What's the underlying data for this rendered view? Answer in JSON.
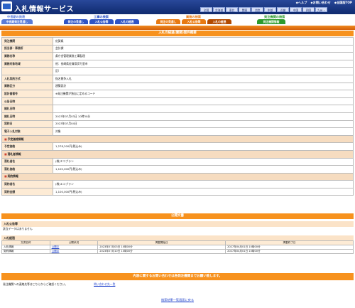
{
  "header": {
    "title": "入札情報サービス",
    "top_links": [
      "◆ヘルプ",
      "◆お問い合わせ",
      "◆全国版TOP"
    ],
    "regions": [
      "全国",
      "北海道",
      "東北",
      "関東",
      "北陸",
      "中部",
      "近畿",
      "中国",
      "四国",
      "九州・沖"
    ]
  },
  "nav": {
    "groups": [
      {
        "label": "中長期の発表",
        "color": "#5a7bd8",
        "buttons": [
          "中長期発注見通し"
        ]
      },
      {
        "label": "工事の検索",
        "color": "#2f54c4",
        "buttons": [
          "発注の見通し",
          "入札公告等",
          "入札の経過"
        ]
      },
      {
        "label": "業務の検索",
        "color": "#e87a12",
        "buttons": [
          "発注の見通し",
          "入札公告等",
          "入札の経過"
        ]
      },
      {
        "label": "発注機関の検索",
        "color": "#2d9a2d",
        "buttons": [
          "発注機関情報"
        ]
      }
    ]
  },
  "section_title": "入札の経過(業務)案件概要",
  "details": [
    {
      "label": "発注機関",
      "value": "佐賀県"
    },
    {
      "label": "担当部・事務所",
      "value": "会計課"
    },
    {
      "label": "業務名称",
      "value": "県庁舎管理業務工事監理"
    },
    {
      "label": "業務対象地域",
      "value": "他：長崎県佐賀県伊万里市"
    },
    {
      "label": "",
      "value": "区）"
    },
    {
      "label": "入札契約方式",
      "value": "指名競争入札"
    },
    {
      "label": "業務区分",
      "value": "建築設計"
    },
    {
      "label": "設計書番号",
      "value": "※発注機関が独自に定めるコード"
    },
    {
      "label": "公告日時",
      "value": ""
    },
    {
      "label": "開札日時",
      "value": ""
    },
    {
      "label": "開札日時",
      "value": "2023年07月03日 10時30分"
    },
    {
      "label": "契約日",
      "value": "2023年07月04日"
    },
    {
      "label": "電子入札対象",
      "value": "対象"
    }
  ],
  "yotei_header": "予定価格情報",
  "yotei": [
    {
      "label": "予定価格",
      "value": "1,278,200円(税込み)"
    }
  ],
  "rakusatsu_header": "落札者情報",
  "rakusatsu": [
    {
      "label": "落札者名",
      "value": "(株)エコプラン"
    },
    {
      "label": "落札価格",
      "value": "1,100,000円(税込み)"
    }
  ],
  "keiyaku_header": "契約情報",
  "keiyaku": [
    {
      "label": "契約者名",
      "value": "(株)エコプラン"
    },
    {
      "label": "契約金額",
      "value": "1,100,000円(税込み)"
    }
  ],
  "public_docs": {
    "title": "公開文書",
    "notice_label": "入札公告等",
    "notice_text": "該当データはありません"
  },
  "keika": {
    "label": "入札経過",
    "headers": [
      "文書名称",
      "公開状況",
      "掲載開始日",
      "掲載終了日"
    ],
    "rows": [
      [
        "入札情報",
        "公開中",
        "2023年07月03日 10時00分",
        "2027年04月01日 10時00分"
      ],
      [
        "契約情報",
        "公開中",
        "2023年07月10日 10時00分",
        "2027年04月01日 10時00分"
      ]
    ]
  },
  "contact": {
    "title": "内容に関するお問い合わせは各発注機関までお願い致します。",
    "text": "発注機関への連絡先等はこちらからご確認ください。",
    "link": "問い合わせ先一覧"
  },
  "back_link": "検索結果一覧画面に戻る"
}
